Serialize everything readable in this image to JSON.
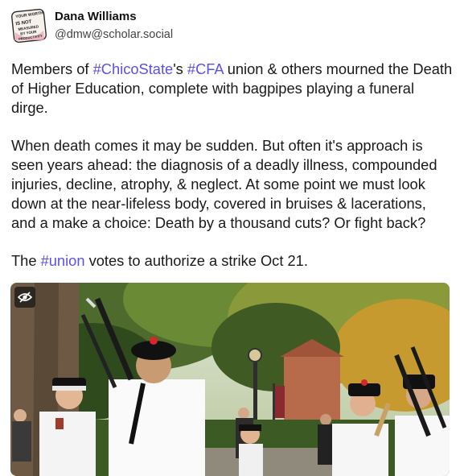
{
  "author": {
    "display_name": "Dana Williams",
    "handle": "@dmw@scholar.social",
    "avatar_text": [
      "YOUR WORTH",
      "IS NOT",
      "MEASURED",
      "BY YOUR",
      "PRODUCTIVITY"
    ]
  },
  "post": {
    "p1": {
      "t1": "Members of ",
      "tag1": "#ChicoState",
      "t2": "'s ",
      "tag2": "#CFA",
      "t3": " union & others mourned the Death of Higher Education, complete with bagpipes playing a funeral dirge."
    },
    "p2": "When death comes it may be sudden. But often it's approach is seen years ahead: the diagnosis of a deadly illness, compounded injuries, decline, atrophy, & neglect. At some point we must look down at the near-lifeless body, covered in bruises & lacerations, and a make a choice: Death by a thousand cuts? Or fight back?",
    "p3": {
      "t1": "The ",
      "tag": "#union",
      "t2": " votes to authorize a strike Oct 21."
    }
  },
  "media": {
    "hide_icon": "eye-slash-icon",
    "description": "bagpipers in white shirts and black glengarry caps playing outdoors under trees"
  },
  "colors": {
    "hashtag": "#5b50e8",
    "text": "#1a1a1a"
  }
}
